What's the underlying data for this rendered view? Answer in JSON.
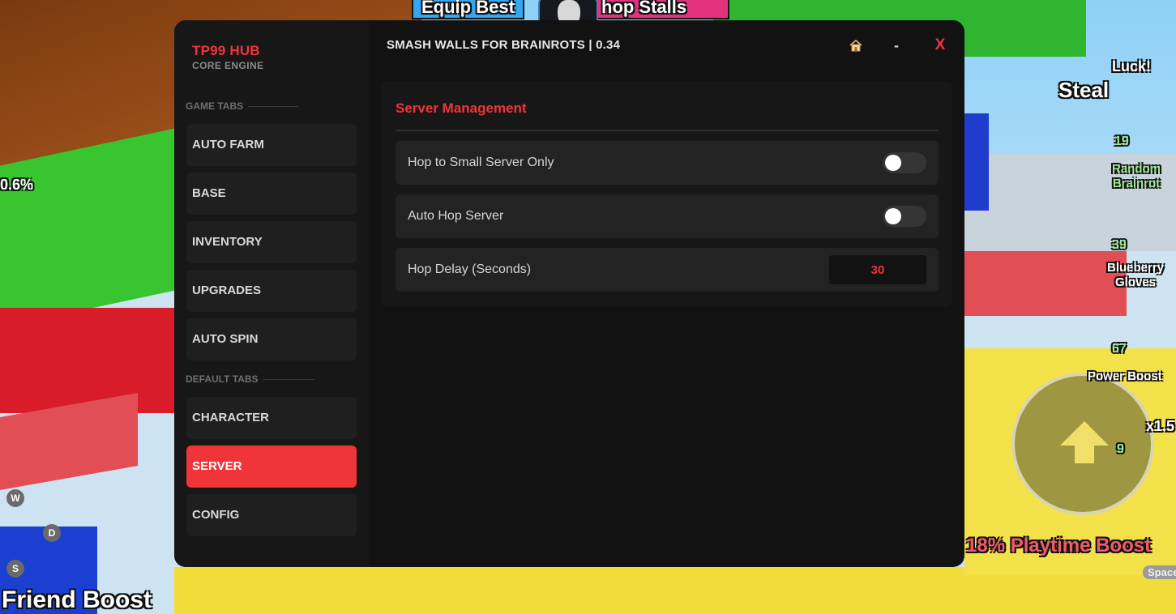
{
  "game_hud": {
    "equip_best": "Equip Best",
    "shop_stalls": "hop Stalls",
    "luck": "Luck!",
    "steal": "Steal",
    "random_brainrot": "Random Brainrot",
    "random_brainrot_count": "39",
    "luck_count": "19",
    "blueberry_gloves": "Blueberry Gloves",
    "blueberry_count": "67",
    "power_boost": "Power Boost",
    "power_multiplier": "x1.5",
    "power_count": "9",
    "playtime_boost": "18% Playtime Boost",
    "friend_boost": "Friend Boost",
    "left_percent": "0.6%",
    "space_key": "Space",
    "key_w": "W",
    "key_d": "D",
    "key_s": "S"
  },
  "hub": {
    "brand_title": "TP99 HUB",
    "brand_subtitle": "CORE ENGINE",
    "window_title": "SMASH WALLS FOR BRAINROTS | 0.34",
    "home_icon": "house-icon",
    "minimize_label": "-",
    "close_label": "X",
    "game_tabs_label": "GAME TABS",
    "default_tabs_label": "DEFAULT TABS",
    "game_tabs": [
      "AUTO FARM",
      "BASE",
      "INVENTORY",
      "UPGRADES",
      "AUTO SPIN"
    ],
    "default_tabs": [
      "CHARACTER",
      "SERVER",
      "CONFIG"
    ],
    "active_tab": "SERVER",
    "accent_color": "#f0353a"
  },
  "server_panel": {
    "title": "Server Management",
    "hop_small_label": "Hop to Small Server Only",
    "hop_small_enabled": false,
    "auto_hop_label": "Auto Hop Server",
    "auto_hop_enabled": false,
    "hop_delay_label": "Hop Delay (Seconds)",
    "hop_delay_value": "30"
  }
}
